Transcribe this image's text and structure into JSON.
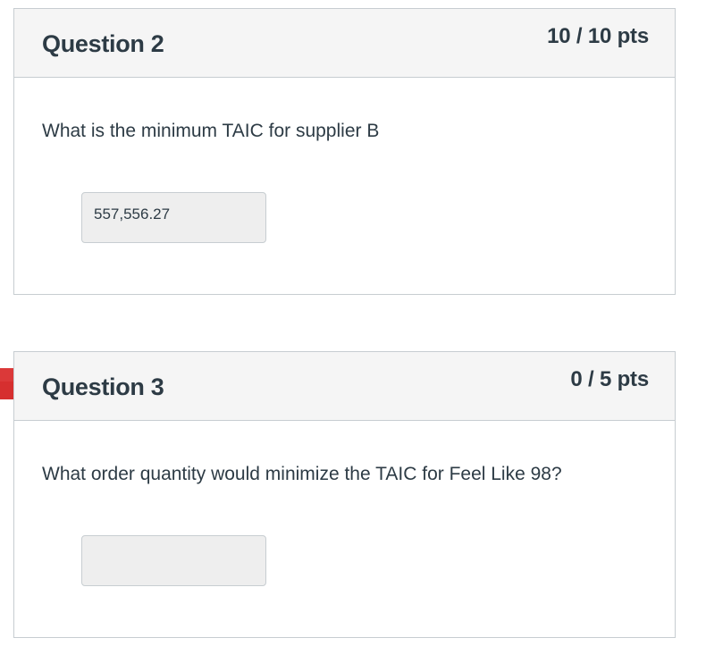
{
  "questions": [
    {
      "title": "Question 2",
      "points": "10 / 10 pts",
      "text": "What is the minimum TAIC for supplier B",
      "answer": "557,556.27"
    },
    {
      "title": "Question 3",
      "points": "0 / 5 pts",
      "text": "What order quantity would minimize the TAIC for Feel Like 98?",
      "answer": ""
    }
  ],
  "colors": {
    "incorrect_marker": "#d62f2f",
    "header_bg": "#f5f5f5",
    "answer_bg": "#eeeeee",
    "border": "#c7cdd1",
    "text": "#2d3b45"
  }
}
